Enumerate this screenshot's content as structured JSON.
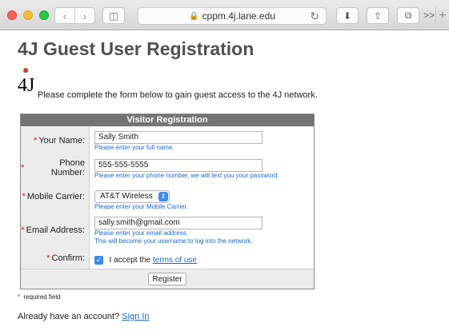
{
  "browser": {
    "url": "cppm.4j.lane.edu",
    "tabs_overflow": ">>",
    "new_tab": "+"
  },
  "page": {
    "title": "4J Guest User Registration",
    "logo_text": "4J",
    "intro": "Please complete the form below to gain guest access to the 4J network."
  },
  "form": {
    "header": "Visitor Registration",
    "name": {
      "label": "Your Name:",
      "value": "Sally Smith",
      "hint": "Please enter your full name."
    },
    "phone": {
      "label": "Phone Number:",
      "value": "555-555-5555",
      "hint": "Please enter your phone number, we will text you your password."
    },
    "carrier": {
      "label": "Mobile Carrier:",
      "value": "AT&T Wireless",
      "hint": "Please enter your Mobile Carrier."
    },
    "email": {
      "label": "Email Address:",
      "value": "sally.smith@gmail.com",
      "hint_1": "Please enter your email address.",
      "hint_2": "This will become your username to log into the network."
    },
    "confirm": {
      "label": "Confirm:",
      "text": "I accept the",
      "link": "terms of use",
      "checked": true
    },
    "submit_label": "Register",
    "required_marker": "*"
  },
  "footer": {
    "required_note": "required field",
    "already_text": "Already have an account?",
    "signin_link": "Sign In"
  },
  "colors": {
    "accent_blue": "#1a6bc8",
    "required_red": "#e3140e",
    "panel_header": "#747474"
  }
}
